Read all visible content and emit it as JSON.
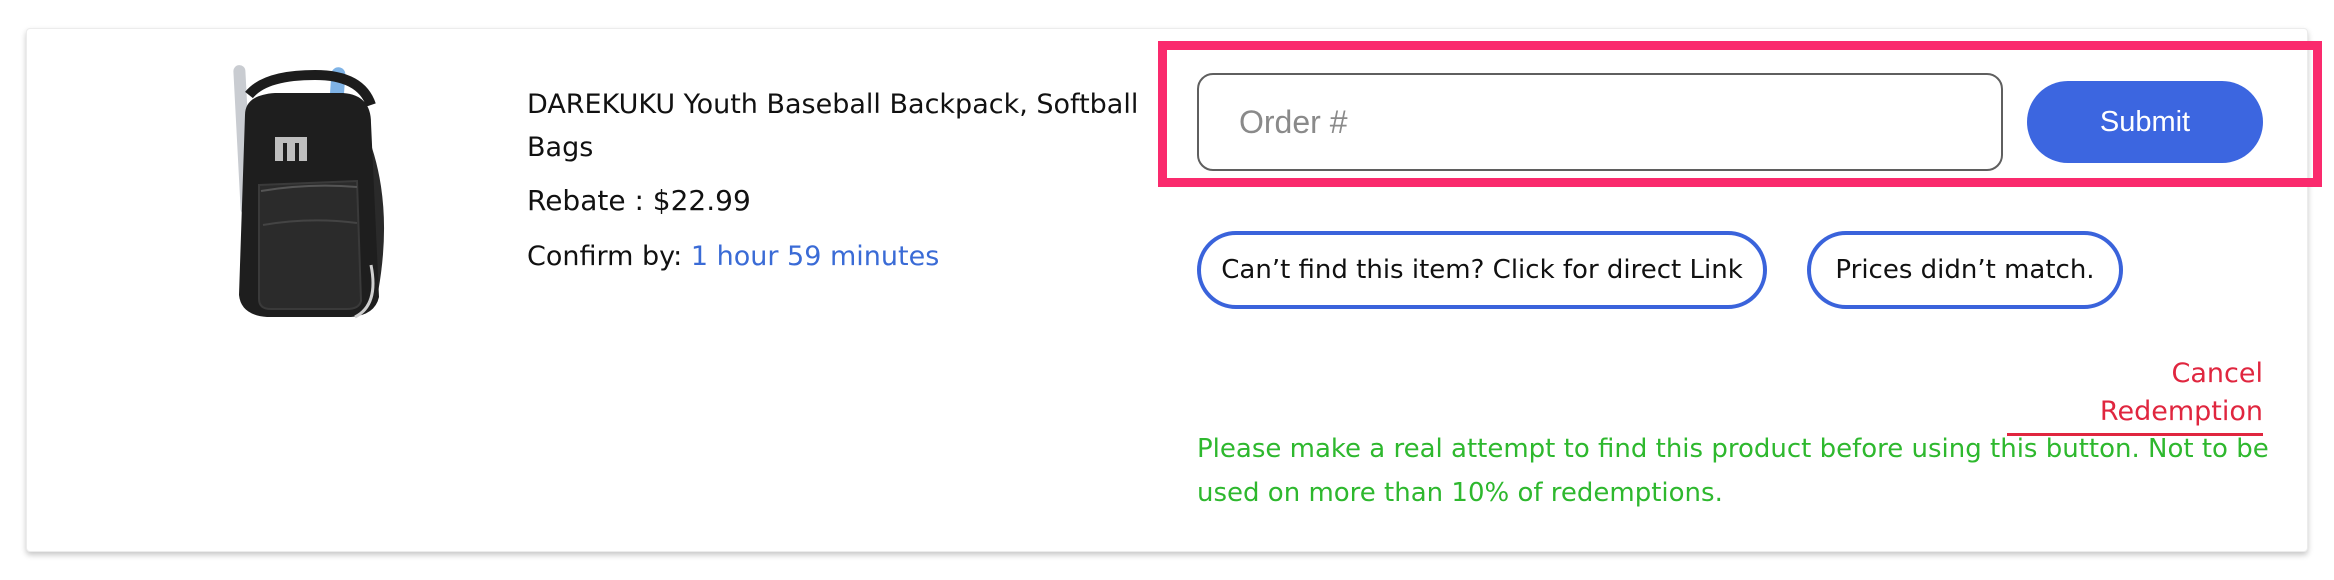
{
  "product": {
    "title": "DAREKUKU Youth Baseball Backpack, Softball Bags",
    "rebate_label": "Rebate : $22.99",
    "confirm_label": "Confirm by:",
    "confirm_time": "1 hour 59 minutes",
    "image_icon": "backpack-image"
  },
  "order": {
    "placeholder": "Order #",
    "value": "",
    "submit_label": "Submit"
  },
  "actions": {
    "direct_link_label": "Can’t find this item? Click for direct Link",
    "prices_label": "Prices didn’t match.",
    "cancel_label": "Cancel Redemption"
  },
  "note": "Please make a real attempt to find this product before using this button. Not to be used on more than 10% of redemptions.",
  "colors": {
    "highlight": "#fa2a6d",
    "primary": "#3c66e0",
    "link": "#3a6bd6",
    "cancel": "#e0263f",
    "note": "#2eb82e"
  }
}
